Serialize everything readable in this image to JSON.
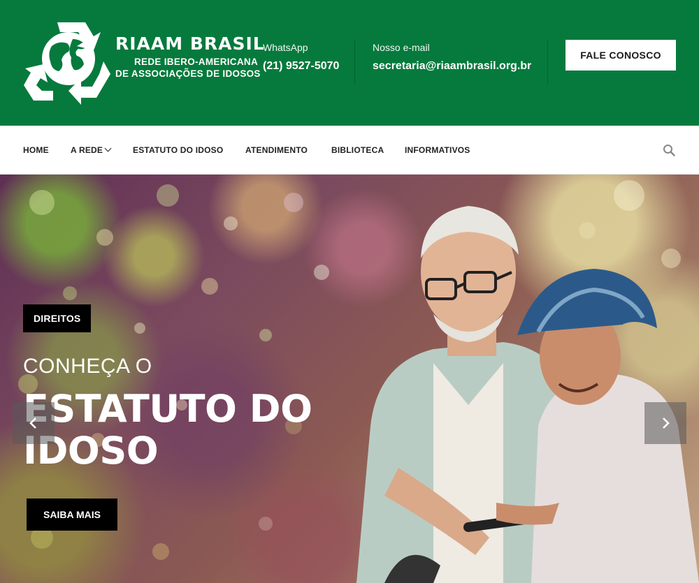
{
  "header": {
    "logo_title": "RIAAM BRASIL",
    "logo_subtitle_line1": "REDE IBERO-AMERICANA",
    "logo_subtitle_line2": "DE ASSOCIAÇÕES DE IDOSOS",
    "whatsapp_label": "WhatsApp",
    "whatsapp_value": "(21) 9527-5070",
    "email_label": "Nosso e-mail",
    "email_value": "secretaria@riaambrasil.org.br",
    "cta_label": "FALE CONOSCO",
    "background_color": "#057a3c"
  },
  "nav": {
    "items": [
      {
        "label": "HOME"
      },
      {
        "label": "A REDE",
        "has_dropdown": true
      },
      {
        "label": "ESTATUTO DO IDOSO"
      },
      {
        "label": "ATENDIMENTO"
      },
      {
        "label": "BIBLIOTECA"
      },
      {
        "label": "INFORMATIVOS"
      }
    ],
    "search_icon": "search-icon"
  },
  "hero": {
    "badge": "DIREITOS",
    "subtitle": "CONHEÇA O",
    "title_line1": "ESTATUTO DO",
    "title_line2": "IDOSO",
    "button_label": "SAIBA MAIS",
    "prev_icon": "chevron-left-icon",
    "next_icon": "chevron-right-icon"
  }
}
